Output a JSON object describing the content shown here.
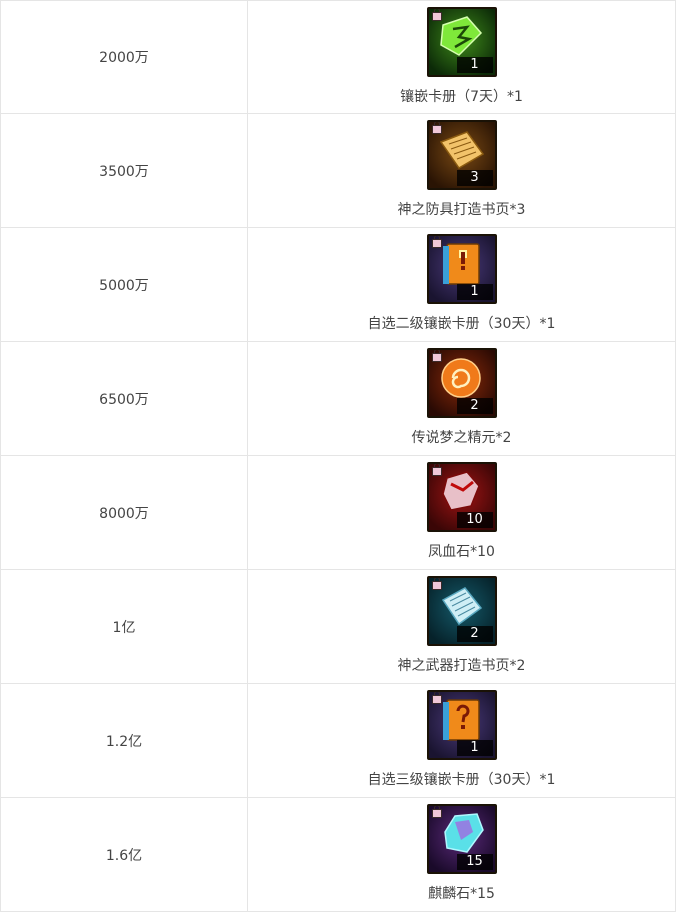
{
  "rows": [
    {
      "threshold": "2000万",
      "count": "1",
      "label": "镶嵌卡册（7天）*1",
      "icon": "green-card-album-icon",
      "colors": {
        "bg1": "#0c2a08",
        "bg2": "#3f8a1a",
        "glyph": "#7fe83a"
      }
    },
    {
      "threshold": "3500万",
      "count": "3",
      "label": "神之防具打造书页*3",
      "icon": "armor-crafting-pages-icon",
      "colors": {
        "bg1": "#2a1404",
        "bg2": "#7a4a14",
        "glyph": "#f2c36a"
      }
    },
    {
      "threshold": "5000万",
      "count": "1",
      "label": "自选二级镶嵌卡册（30天）*1",
      "icon": "orange-card-book-exclamation-icon",
      "colors": {
        "bg1": "#1a1430",
        "bg2": "#4a3a7a",
        "glyph": "#f08a1a"
      }
    },
    {
      "threshold": "6500万",
      "count": "2",
      "label": "传说梦之精元*2",
      "icon": "legend-dream-essence-icon",
      "colors": {
        "bg1": "#2a0a04",
        "bg2": "#8a2a08",
        "glyph": "#f07a1a"
      }
    },
    {
      "threshold": "8000万",
      "count": "10",
      "label": "凤血石*10",
      "icon": "phoenix-blood-stone-icon",
      "colors": {
        "bg1": "#3a0606",
        "bg2": "#a01414",
        "glyph": "#e8c0c8"
      }
    },
    {
      "threshold": "1亿",
      "count": "2",
      "label": "神之武器打造书页*2",
      "icon": "weapon-crafting-pages-icon",
      "colors": {
        "bg1": "#06222a",
        "bg2": "#155a6a",
        "glyph": "#cfeef5"
      }
    },
    {
      "threshold": "1.2亿",
      "count": "1",
      "label": "自选三级镶嵌卡册（30天）*1",
      "icon": "orange-card-book-question-icon",
      "colors": {
        "bg1": "#1a1430",
        "bg2": "#4a3a7a",
        "glyph": "#f08a1a"
      }
    },
    {
      "threshold": "1.6亿",
      "count": "15",
      "label": "麒麟石*15",
      "icon": "qilin-stone-icon",
      "colors": {
        "bg1": "#1a0a2a",
        "bg2": "#5a2a7a",
        "glyph": "#5ae0e8"
      }
    }
  ]
}
